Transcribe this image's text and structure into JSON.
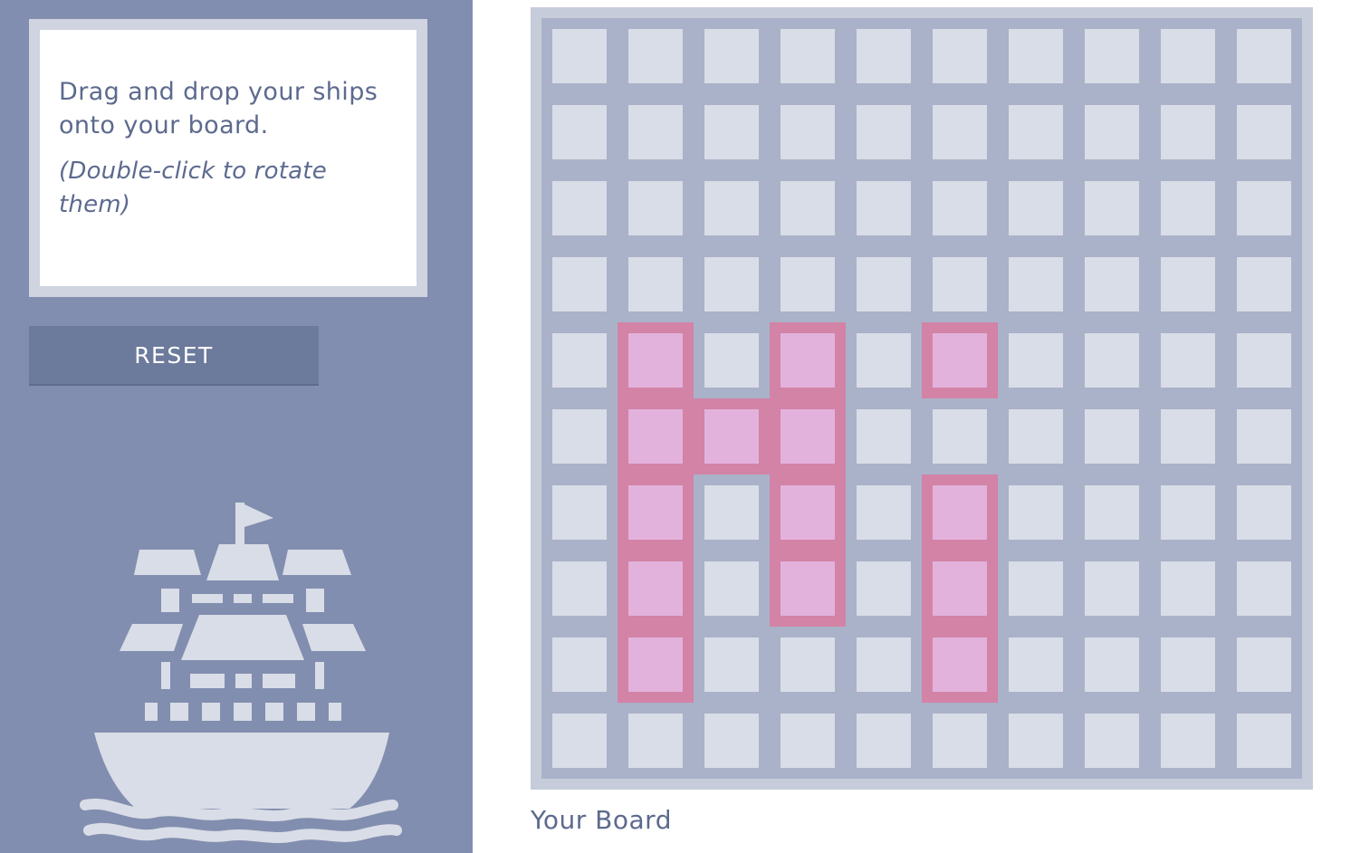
{
  "instructions": {
    "main_text": "Drag and drop your ships onto your board.",
    "hint_text": "(Double-click to rotate them)"
  },
  "reset_button": {
    "label": "RESET"
  },
  "illustration": {
    "icon": "ship-icon"
  },
  "board": {
    "caption": "Your Board",
    "rows": 10,
    "cols": 10,
    "ships": [
      {
        "name": "ship-1",
        "cells": [
          [
            4,
            1
          ],
          [
            5,
            1
          ],
          [
            6,
            1
          ],
          [
            7,
            1
          ],
          [
            8,
            1
          ]
        ]
      },
      {
        "name": "ship-2",
        "cells": [
          [
            5,
            2
          ]
        ]
      },
      {
        "name": "ship-3",
        "cells": [
          [
            4,
            3
          ],
          [
            5,
            3
          ],
          [
            6,
            3
          ],
          [
            7,
            3
          ]
        ]
      },
      {
        "name": "ship-4",
        "cells": [
          [
            4,
            5
          ]
        ]
      },
      {
        "name": "ship-5",
        "cells": [
          [
            6,
            5
          ],
          [
            7,
            5
          ],
          [
            8,
            5
          ]
        ]
      }
    ]
  },
  "colors": {
    "sidebar": "#828eaf",
    "cell": "#d9dde7",
    "grid": "#aab2c9",
    "ship": "#e27098",
    "ship_core": "#e2b4de",
    "text": "#5d6a8e",
    "button": "#6c7a9c"
  }
}
